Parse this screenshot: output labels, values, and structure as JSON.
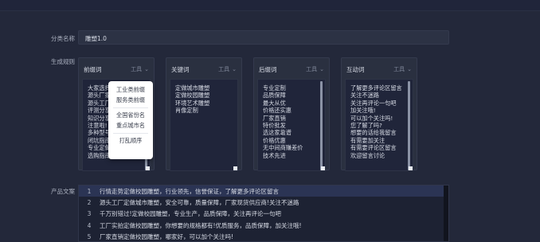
{
  "labels": {
    "category_name": "分类名称",
    "gen_rules": "生成规则",
    "copywriting": "产品文案"
  },
  "category_value": "雕塑1.0",
  "cards": [
    {
      "title": "前缀词",
      "tools": "工具",
      "items": [
        "大家选择",
        "源头厂家",
        "源头工厂",
        "评测分享",
        "知识分享",
        "注意啦!",
        "多种型号",
        "闭坑指南",
        "专业定做",
        "选购指南"
      ]
    },
    {
      "title": "关键词",
      "tools": "工具",
      "items": [
        "定做城市雕塑",
        "定做校园雕塑",
        "环境艺术雕塑",
        "肖像定制"
      ]
    },
    {
      "title": "后缀词",
      "tools": "工具",
      "items": [
        "专业定制",
        "品质保障",
        "最大从优",
        "价格还实惠",
        "厂家直销",
        "特价批发",
        "选这家靠谱",
        "价格优惠",
        "无中间商赚差价",
        "技术先进"
      ]
    },
    {
      "title": "互动词",
      "tools": "工具",
      "items": [
        "了解更多评论区留言",
        "关注不迷路",
        "关注再评论一句吧",
        "加关注哦!",
        "可以加个关注吗!",
        "您了解了吗?",
        "想要的话给我留言",
        "有需要加关注",
        "有需要评论区留言",
        "欢迎留言讨论"
      ]
    }
  ],
  "popup_options": [
    "工业类前缀",
    "服务类前缀",
    "全国省份名",
    "重点城市名",
    "打乱顺序"
  ],
  "rows": [
    {
      "n": "1",
      "text": "行情走势定做校园雕塑，行业领先，信誉保证，了解更多评论区留言"
    },
    {
      "n": "2",
      "text": "源头工厂定做城市雕塑，安全可靠，质量保障，厂家现货供应商!关注不迷路"
    },
    {
      "n": "3",
      "text": "千万别错过!定做校园雕塑，专业生产，品质保障，关注再评论一句吧"
    },
    {
      "n": "4",
      "text": "工厂实拍定做校园雕塑，你想要的规格都有!优质服务，品质保障，加关注哦!"
    },
    {
      "n": "5",
      "text": "厂家直销定做校园雕塑，哪家好，可以加个关注吗!"
    }
  ]
}
